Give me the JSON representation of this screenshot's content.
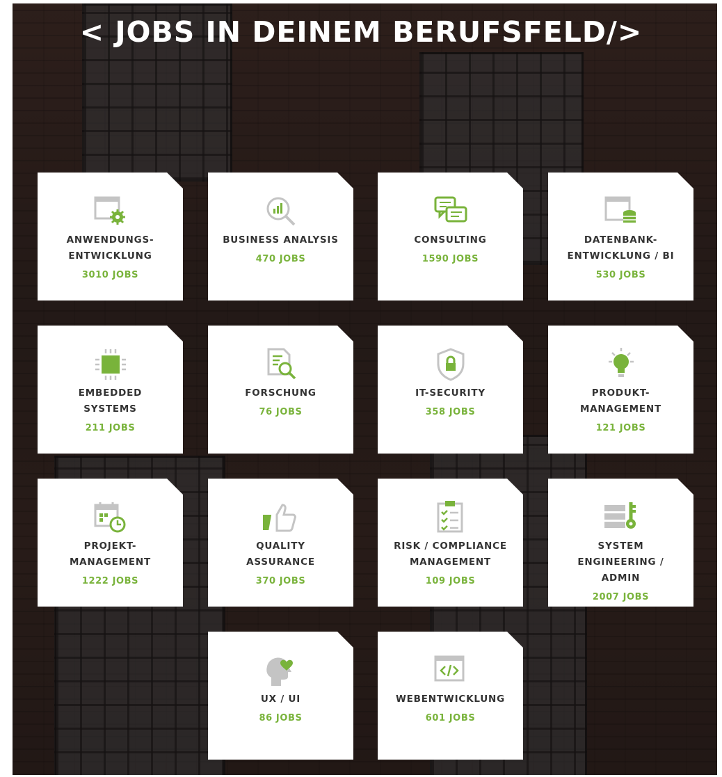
{
  "page": {
    "title": "< JOBS IN DEINEM BERUFSFELD/>"
  },
  "colors": {
    "accent": "#79b33b",
    "icon_gray": "#c4c4c4",
    "text_dark": "#333333",
    "tile_bg": "#ffffff"
  },
  "categories": [
    {
      "name": "ANWENDUNGS-\nENTWICKLUNG",
      "count": "3010 JOBS",
      "icon": "app-gear-icon"
    },
    {
      "name": "BUSINESS ANALYSIS",
      "count": "470 JOBS",
      "icon": "magnifier-chart-icon"
    },
    {
      "name": "CONSULTING",
      "count": "1590 JOBS",
      "icon": "chat-bubbles-icon"
    },
    {
      "name": "DATENBANK-\nENTWICKLUNG / BI",
      "count": "530 JOBS",
      "icon": "database-window-icon"
    },
    {
      "name": "EMBEDDED\nSYSTEMS",
      "count": "211 JOBS",
      "icon": "chip-icon"
    },
    {
      "name": "FORSCHUNG",
      "count": "76 JOBS",
      "icon": "document-search-icon"
    },
    {
      "name": "IT-SECURITY",
      "count": "358 JOBS",
      "icon": "shield-lock-icon"
    },
    {
      "name": "PRODUKT-\nMANAGEMENT",
      "count": "121 JOBS",
      "icon": "lightbulb-icon"
    },
    {
      "name": "PROJEKT-\nMANAGEMENT",
      "count": "1222 JOBS",
      "icon": "calendar-clock-icon"
    },
    {
      "name": "QUALITY\nASSURANCE",
      "count": "370 JOBS",
      "icon": "thumbs-up-icon"
    },
    {
      "name": "RISK / COMPLIANCE\nMANAGEMENT",
      "count": "109 JOBS",
      "icon": "checklist-icon"
    },
    {
      "name": "SYSTEM\nENGINEERING /\nADMIN",
      "count": "2007 JOBS",
      "icon": "server-key-icon"
    },
    {
      "name": "UX / UI",
      "count": "86 JOBS",
      "icon": "head-heart-icon"
    },
    {
      "name": "WEBENTWICKLUNG",
      "count": "601 JOBS",
      "icon": "code-window-icon"
    }
  ]
}
